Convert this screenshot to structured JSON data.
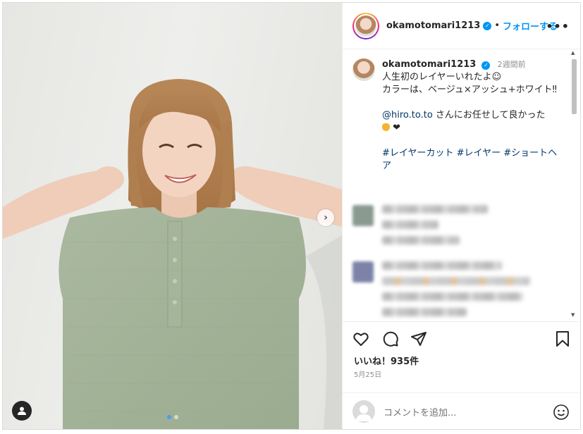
{
  "post": {
    "username": "okamotomari1213",
    "verified_mark": "✓",
    "separator": "•",
    "follow_label": "フォローする",
    "more_label": "•••"
  },
  "caption": {
    "username": "okamotomari1213",
    "time": "2週間前",
    "line1": "人生初のレイヤーいれたよ☺",
    "line2": "カラーは、ベージュ×アッシュ+ホワイト‼",
    "mention": "@hiro.to.to",
    "line3": " さんにお任せして良かった",
    "line4_heart": "❤",
    "hashtags": "#レイヤーカット #レイヤー #ショートヘア"
  },
  "media": {
    "next_icon": "›",
    "slide_count": 2,
    "active_slide": 1
  },
  "engagement": {
    "likes": "いいね！935件",
    "date": "5月25日"
  },
  "comment_box": {
    "placeholder": "コメントを追加..."
  },
  "icons": [
    "heart-icon",
    "comment-icon",
    "share-icon",
    "bookmark-icon",
    "emoji-icon",
    "user-tag-icon",
    "chevron-right-icon",
    "verified-badge-icon"
  ],
  "colors": {
    "accent": "#0095f6",
    "text": "#262626",
    "muted": "#8e8e8e",
    "link": "#00376b"
  }
}
